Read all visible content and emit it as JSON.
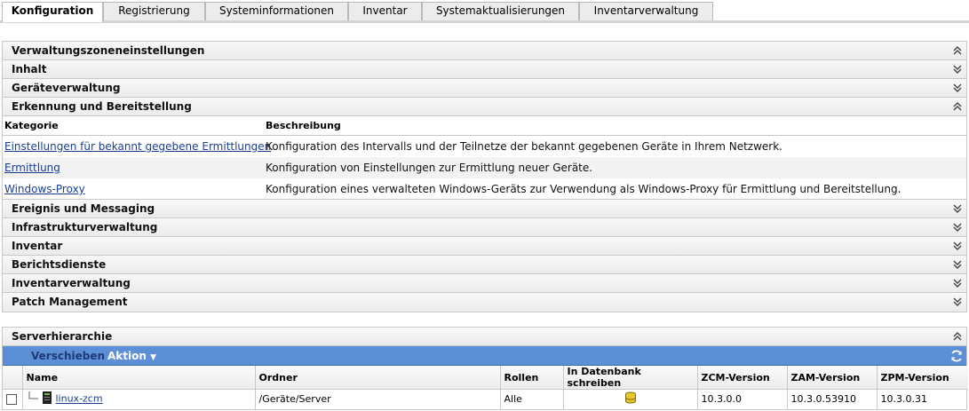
{
  "tabs": [
    {
      "label": "Konfiguration",
      "active": true
    },
    {
      "label": "Registrierung",
      "active": false
    },
    {
      "label": "Systeminformationen",
      "active": false
    },
    {
      "label": "Inventar",
      "active": false
    },
    {
      "label": "Systemaktualisierungen",
      "active": false
    },
    {
      "label": "Inventarverwaltung",
      "active": false
    }
  ],
  "zone_settings": {
    "title": "Verwaltungszoneneinstellungen",
    "sections_top": [
      {
        "label": "Inhalt",
        "state": "collapsed"
      },
      {
        "label": "Geräteverwaltung",
        "state": "collapsed"
      },
      {
        "label": "Erkennung und Bereitstellung",
        "state": "expanded"
      }
    ],
    "table": {
      "col_category": "Kategorie",
      "col_description": "Beschreibung",
      "rows": [
        {
          "link": "Einstellungen für bekannt gegebene Ermittlungen",
          "desc": "Konfiguration des Intervalls und der Teilnetze der bekannt gegebenen Geräte in Ihrem Netzwerk."
        },
        {
          "link": "Ermittlung",
          "desc": "Konfiguration von Einstellungen zur Ermittlung neuer Geräte."
        },
        {
          "link": "Windows-Proxy",
          "desc": "Konfiguration eines verwalteten Windows-Geräts zur Verwendung als Windows-Proxy für Ermittlung und Bereitstellung."
        }
      ]
    },
    "sections_bottom": [
      {
        "label": "Ereignis und Messaging",
        "state": "collapsed"
      },
      {
        "label": "Infrastrukturverwaltung",
        "state": "collapsed"
      },
      {
        "label": "Inventar",
        "state": "collapsed"
      },
      {
        "label": "Berichtsdienste",
        "state": "collapsed"
      },
      {
        "label": "Inventarverwaltung",
        "state": "collapsed"
      },
      {
        "label": "Patch Management",
        "state": "collapsed"
      }
    ]
  },
  "server_hierarchy": {
    "title": "Serverhierarchie",
    "toolbar": {
      "move": "Verschieben",
      "action": "Aktion"
    },
    "columns": [
      "Name",
      "Ordner",
      "Rollen",
      "In Datenbank schreiben",
      "ZCM-Version",
      "ZAM-Version",
      "ZPM-Version"
    ],
    "rows": [
      {
        "name": "linux-zcm",
        "folder": "/Geräte/Server",
        "roles": "Alle",
        "db_icon": "database-icon",
        "zcm": "10.3.0.0",
        "zam": "10.3.0.53910",
        "zpm": "10.3.0.31"
      }
    ]
  },
  "colors": {
    "toolbar": "#5d8fd6",
    "link": "#1a3f8f"
  }
}
